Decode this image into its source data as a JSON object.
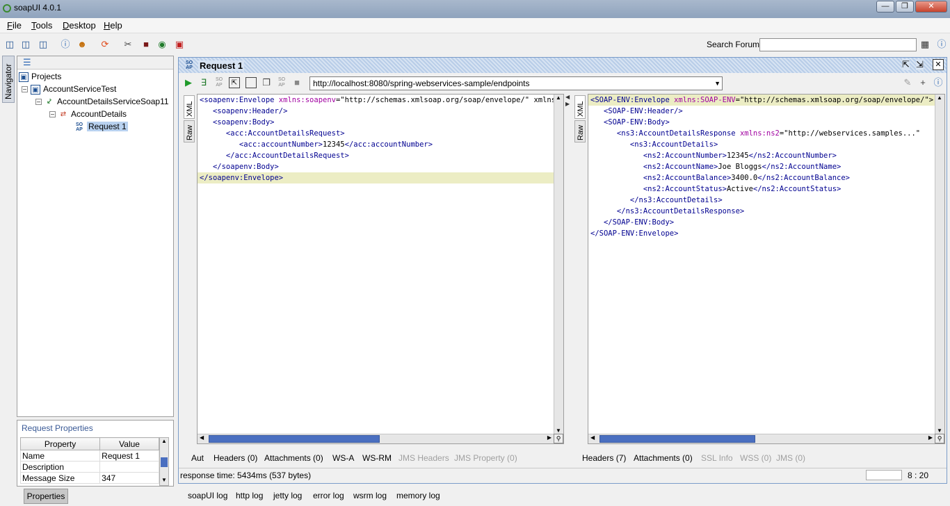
{
  "window": {
    "title": "soapUI 4.0.1"
  },
  "menu": [
    {
      "label": "File",
      "mnemonic": "F",
      "rest": "ile"
    },
    {
      "label": "Tools",
      "mnemonic": "T",
      "rest": "ools"
    },
    {
      "label": "Desktop",
      "mnemonic": "D",
      "rest": "esktop"
    },
    {
      "label": "Help",
      "mnemonic": "H",
      "rest": "elp"
    }
  ],
  "toolbar": {
    "search_label": "Search Forum",
    "search_value": ""
  },
  "navigator": {
    "tab_label": "Navigator",
    "tree": [
      {
        "label": "Projects",
        "icon": "projects-icon"
      },
      {
        "label": "AccountServiceTest",
        "icon": "project-icon"
      },
      {
        "label": "AccountDetailsServiceSoap11",
        "icon": "interface-icon"
      },
      {
        "label": "AccountDetails",
        "icon": "operation-icon"
      },
      {
        "label": "Request 1",
        "icon": "soap-request-icon"
      }
    ]
  },
  "properties": {
    "title": "Request Properties",
    "columns": [
      "Property",
      "Value"
    ],
    "rows": [
      {
        "name": "Name",
        "value": "Request 1"
      },
      {
        "name": "Description",
        "value": ""
      },
      {
        "name": "Message Size",
        "value": "347"
      }
    ],
    "button_label": "Properties"
  },
  "request": {
    "title": "Request 1",
    "endpoint": "http://localhost:8080/spring-webservices-sample/endpoints",
    "side_tabs": {
      "xml": "XML",
      "raw": "Raw"
    },
    "request_tabs": [
      {
        "label": "Aut",
        "enabled": true
      },
      {
        "label": "Headers (0)",
        "enabled": true
      },
      {
        "label": "Attachments (0)",
        "enabled": true
      },
      {
        "label": "WS-A",
        "enabled": true
      },
      {
        "label": "WS-RM",
        "enabled": true
      },
      {
        "label": "JMS Headers",
        "enabled": false
      },
      {
        "label": "JMS Property (0)",
        "enabled": false
      }
    ],
    "response_tabs": [
      {
        "label": "Headers (7)",
        "enabled": true
      },
      {
        "label": "Attachments (0)",
        "enabled": true
      },
      {
        "label": "SSL Info",
        "enabled": false
      },
      {
        "label": "WSS (0)",
        "enabled": false
      },
      {
        "label": "JMS (0)",
        "enabled": false
      }
    ],
    "status": "response time: 5434ms (537 bytes)",
    "cursor_pos": "8 : 20"
  },
  "log_tabs": [
    "soapUI log",
    "http log",
    "jetty log",
    "error log",
    "wsrm log",
    "memory log"
  ],
  "colors": {
    "tag": "#000090",
    "attr": "#a000a0",
    "highlight": "#ecedc4",
    "selection": "#b8d1ef"
  }
}
